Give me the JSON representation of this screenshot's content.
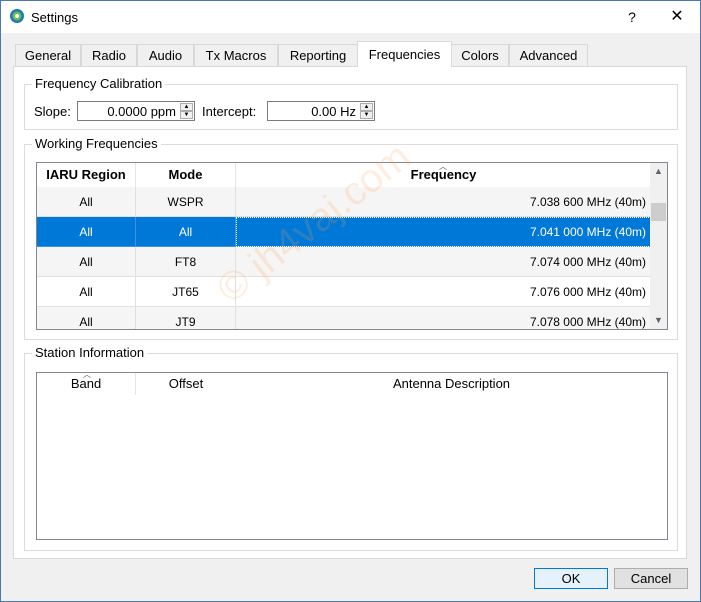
{
  "window": {
    "title": "Settings",
    "help": "?",
    "close": "✕"
  },
  "tabs": [
    {
      "label": "General"
    },
    {
      "label": "Radio"
    },
    {
      "label": "Audio"
    },
    {
      "label": "Tx Macros"
    },
    {
      "label": "Reporting"
    },
    {
      "label": "Frequencies"
    },
    {
      "label": "Colors"
    },
    {
      "label": "Advanced"
    }
  ],
  "active_tab": "Frequencies",
  "calibration": {
    "legend": "Frequency Calibration",
    "slope_label": "Slope:",
    "slope_value": "0.0000 ppm",
    "intercept_label": "Intercept:",
    "intercept_value": "0.00 Hz"
  },
  "working": {
    "legend": "Working Frequencies",
    "columns": [
      "IARU Region",
      "Mode",
      "Frequency"
    ],
    "rows": [
      {
        "region": "All",
        "mode": "WSPR",
        "freq": "7.038 600 MHz (40m)"
      },
      {
        "region": "All",
        "mode": "All",
        "freq": "7.041 000 MHz (40m)"
      },
      {
        "region": "All",
        "mode": "FT8",
        "freq": "7.074 000 MHz (40m)"
      },
      {
        "region": "All",
        "mode": "JT65",
        "freq": "7.076 000 MHz (40m)"
      },
      {
        "region": "All",
        "mode": "JT9",
        "freq": "7.078 000 MHz (40m)"
      }
    ],
    "selected_index": 1
  },
  "station": {
    "legend": "Station Information",
    "columns": [
      "Band",
      "Offset",
      "Antenna Description"
    ]
  },
  "buttons": {
    "ok": "OK",
    "cancel": "Cancel"
  },
  "watermark": "© jh4vaj.com",
  "colors": {
    "selection": "#0078d7",
    "default_button_border": "#0078d7"
  }
}
